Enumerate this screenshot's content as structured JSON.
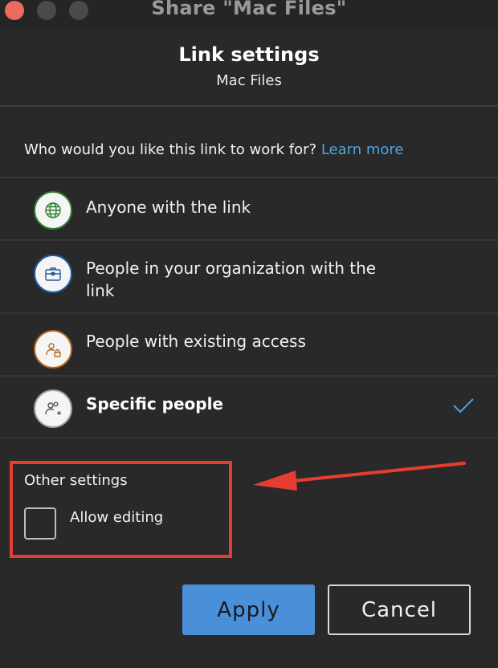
{
  "window": {
    "title": "Share \"Mac Files\""
  },
  "header": {
    "title": "Link settings",
    "subtitle": "Mac Files"
  },
  "question": {
    "text": "Who would you like this link to work for?",
    "link": "Learn more"
  },
  "options": [
    {
      "label": "Anyone with the link",
      "icon": "globe-icon",
      "icon_color": "#2e7d32",
      "selected": false
    },
    {
      "label": "People in your organization with the link",
      "icon": "briefcase-icon",
      "icon_color": "#1f5aa6",
      "selected": false
    },
    {
      "label": "People with existing access",
      "icon": "people-lock-icon",
      "icon_color": "#b5651d",
      "selected": false
    },
    {
      "label": "Specific people",
      "icon": "people-add-icon",
      "icon_color": "#555555",
      "selected": true
    }
  ],
  "other_settings": {
    "title": "Other settings",
    "allow_editing_label": "Allow editing",
    "allow_editing_checked": false
  },
  "buttons": {
    "apply": "Apply",
    "cancel": "Cancel"
  },
  "colors": {
    "accent": "#4a90d9",
    "link": "#4fa3e0",
    "annotation": "#e53d2f",
    "background": "#292929"
  }
}
